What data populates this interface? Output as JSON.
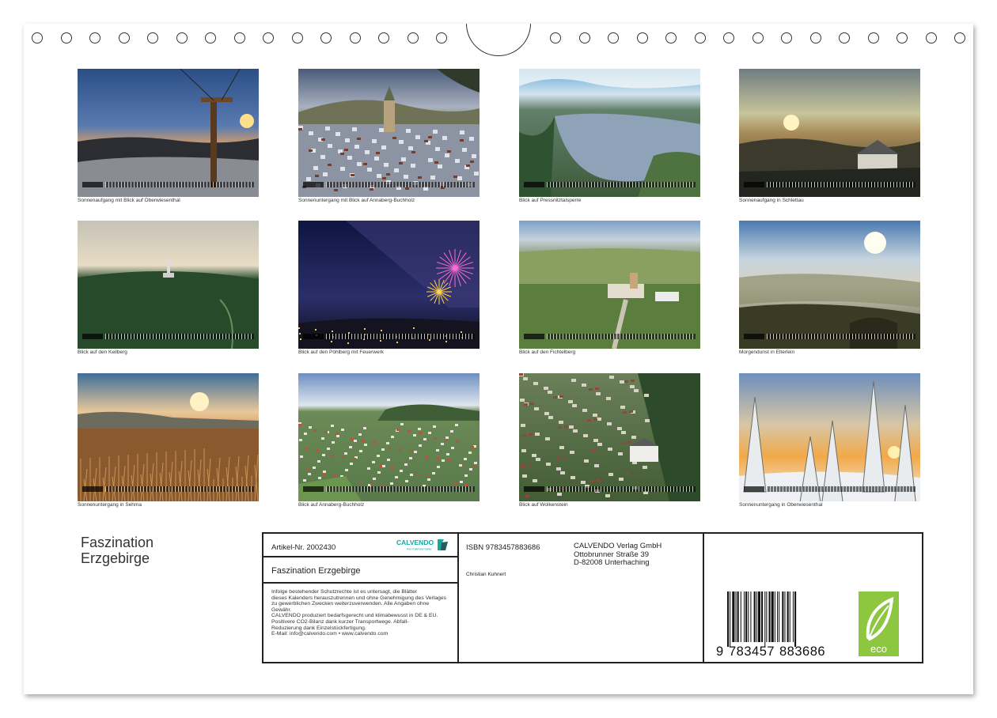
{
  "calendar": {
    "title_lines": [
      "Faszination",
      "Erzgebirge"
    ],
    "photos": [
      {
        "caption": "Sonnenaufgang mit Blick auf Oberwiesenthal",
        "scene": "cable-car-sunrise"
      },
      {
        "caption": "Sonnenuntergang mit Blick auf Annaberg-Buchholz",
        "scene": "town-winter"
      },
      {
        "caption": "Blick auf Pressnitztalsperre",
        "scene": "lake-aerial"
      },
      {
        "caption": "Sonnenaufgang in Schlettau",
        "scene": "castle-sunrise"
      },
      {
        "caption": "Blick auf den Keilberg",
        "scene": "forest-tower"
      },
      {
        "caption": "Blick auf den Pöhlberg mit Feuerwerk",
        "scene": "fireworks-night"
      },
      {
        "caption": "Blick auf den Fichtelberg",
        "scene": "fichtelberg-aerial"
      },
      {
        "caption": "Morgendunst in Elterlein",
        "scene": "misty-morning"
      },
      {
        "caption": "Sonnenuntergang in Sehma",
        "scene": "wheat-sunset"
      },
      {
        "caption": "Blick auf Annaberg-Buchholz",
        "scene": "town-summer"
      },
      {
        "caption": "Blick auf Wolkenstein",
        "scene": "wolkenstein-aerial"
      },
      {
        "caption": "Sonnenuntergang in Oberwiesenthal",
        "scene": "snow-trees-sunset"
      }
    ]
  },
  "imprint": {
    "article_no": "Artikel-Nr. 2002430",
    "logo_text": "CALVENDO",
    "logo_sub": "Ihre Kalendermarke",
    "product_title": "Faszination Erzgebirge",
    "legal_lines": [
      "Infolge bestehender Schutzrechte ist es untersagt, die Blätter",
      "dieses Kalenders herauszutrennen und ohne Genehmigung des Verlages",
      "zu gewerblichen Zwecken weiterzuverwenden. Alle Angaben ohne",
      "Gewähr.",
      "CALVENDO produziert bedarfsgerecht und klimabewusst in DE & EU.",
      "Positivere CO2-Bilanz dank kurzer Transportwege. Abfall-",
      "Reduzierung dank Einzelstückfertigung.",
      "E-Mail: info@calvendo.com • www.calvendo.com"
    ],
    "isbn": "ISBN 9783457883686",
    "author": "Christian Kuhnert",
    "publisher_lines": [
      "CALVENDO Verlag GmbH",
      "Ottobrunner Straße 39",
      "D-82008 Unterhaching"
    ],
    "barcode_digits": [
      "9",
      "783457",
      "883686"
    ],
    "eco_label": "eco"
  },
  "colors": {
    "eco_green": "#8dc63f",
    "logo_teal": "#17a6a0",
    "border": "#222222"
  }
}
